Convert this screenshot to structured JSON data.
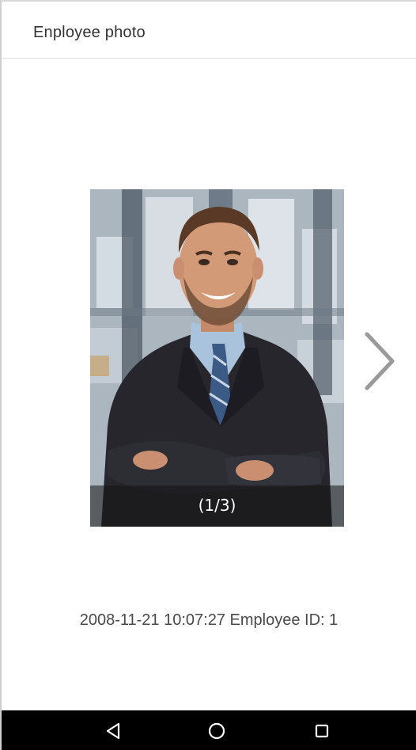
{
  "header": {
    "title": "Enployee photo"
  },
  "photo": {
    "counter": "(1/3)",
    "current": 1,
    "total": 3
  },
  "caption": {
    "text": "2008-11-21 10:07:27 Employee ID: 1"
  },
  "navigation": {
    "next_icon": "chevron-right-icon",
    "back_icon": "triangle-back-icon",
    "home_icon": "circle-home-icon",
    "recents_icon": "square-recents-icon"
  },
  "colors": {
    "background": "#ffffff",
    "header_text": "#333333",
    "caption_text": "#4a4a4a",
    "arrow": "#9a9a9a",
    "navbar": "#000000"
  }
}
